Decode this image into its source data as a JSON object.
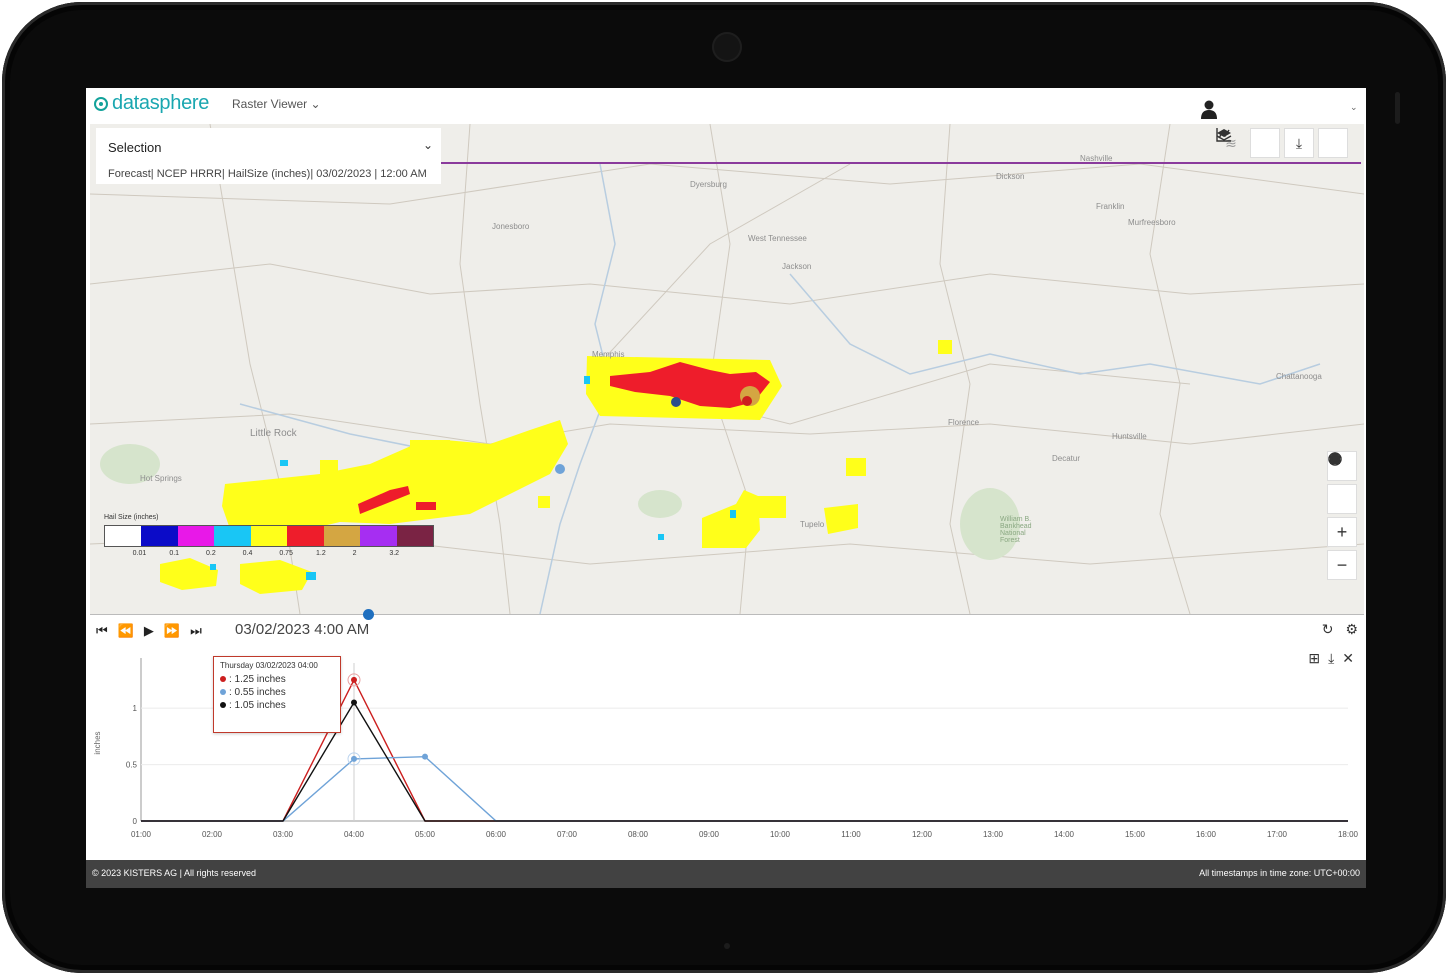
{
  "app": {
    "logo_text": "datasphere",
    "menu_label": "Raster Viewer",
    "menu_caret": "⌄",
    "top_caret": "⌄"
  },
  "selection": {
    "title": "Selection",
    "caret": "⌄",
    "subtitle": "Forecast| NCEP HRRR| HailSize (inches)| 03/02/2023 | 12:00 AM"
  },
  "map": {
    "places": [
      {
        "name": "Nashville"
      },
      {
        "name": "Dyersburg"
      },
      {
        "name": "Dickson"
      },
      {
        "name": "Franklin"
      },
      {
        "name": "Murfreesboro"
      },
      {
        "name": "Jonesboro"
      },
      {
        "name": "West Tennessee"
      },
      {
        "name": "Jackson"
      },
      {
        "name": "Memphis"
      },
      {
        "name": "Chattanooga"
      },
      {
        "name": "Little Rock"
      },
      {
        "name": "Florence"
      },
      {
        "name": "Huntsville"
      },
      {
        "name": "Decatur"
      },
      {
        "name": "Hot Springs"
      },
      {
        "name": "Tupelo"
      },
      {
        "name": "William B. Bankhead National Forest"
      }
    ],
    "icons": [
      "wind-icon",
      "chart-icon",
      "download-icon",
      "layers-icon",
      "home-icon",
      "locate-icon",
      "zoom-in-icon",
      "zoom-out-icon"
    ],
    "legend": {
      "title": "Hail Size (inches)",
      "colors": [
        "#ffffff",
        "#0b0bc8",
        "#e818e8",
        "#19c6f5",
        "#ffff1a",
        "#ee1d2b",
        "#d4a642",
        "#a62ef2",
        "#7a2344"
      ],
      "ticks": [
        "0.01",
        "0.1",
        "0.2",
        "0.4",
        "0.75",
        "1.2",
        "2",
        "3.2"
      ]
    }
  },
  "timeline": {
    "timestamp": "03/02/2023 4:00 AM",
    "controls": [
      "skip-back",
      "rewind",
      "play",
      "fast-forward",
      "skip-forward"
    ],
    "progress": 0.24
  },
  "chart_tools": [
    "grid-icon",
    "download-icon",
    "close-icon"
  ],
  "chart_data": {
    "type": "line",
    "ylabel": "inches",
    "xlabel": "",
    "categories": [
      "01:00",
      "02:00",
      "03:00",
      "04:00",
      "05:00",
      "06:00",
      "07:00",
      "08:00",
      "09:00",
      "10:00",
      "11:00",
      "12:00",
      "13:00",
      "14:00",
      "15:00",
      "16:00",
      "17:00",
      "18:00"
    ],
    "y_ticks": [
      "0",
      "0.5",
      "1"
    ],
    "ylim": [
      0,
      1.4
    ],
    "series": [
      {
        "color": "#cc1f1f",
        "values": [
          0,
          0,
          0,
          1.25,
          0,
          0,
          0,
          0,
          0,
          0,
          0,
          0,
          0,
          0,
          0,
          0,
          0,
          0
        ]
      },
      {
        "color": "#6fa3d8",
        "values": [
          0,
          0,
          0,
          0.55,
          0.57,
          0,
          0,
          0,
          0,
          0,
          0,
          0,
          0,
          0,
          0,
          0,
          0,
          0
        ]
      },
      {
        "color": "#111111",
        "values": [
          0,
          0,
          0,
          1.05,
          0,
          0,
          0,
          0,
          0,
          0,
          0,
          0,
          0,
          0,
          0,
          0,
          0,
          0
        ]
      }
    ],
    "tooltip": {
      "header": "Thursday 03/02/2023 04:00",
      "rows": [
        {
          "color": "#cc1f1f",
          "text": ": 1.25 inches"
        },
        {
          "color": "#6fa3d8",
          "text": ": 0.55 inches"
        },
        {
          "color": "#111111",
          "text": ": 1.05 inches"
        }
      ]
    }
  },
  "footer": {
    "left": "© 2023 KISTERS AG | All rights reserved",
    "right": "All timestamps in time zone: UTC+00:00"
  }
}
